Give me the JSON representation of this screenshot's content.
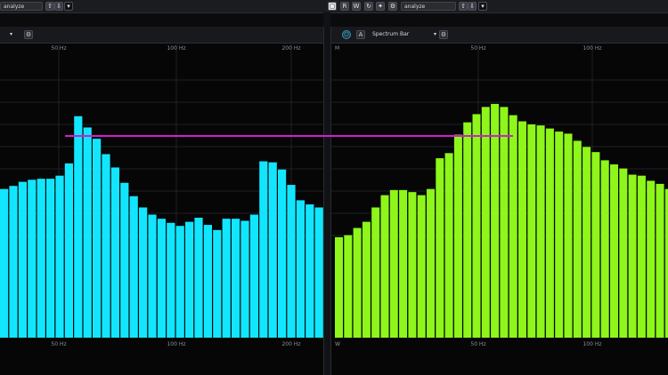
{
  "top_toolbar": {
    "left_dropdown": {
      "value": "analyze"
    },
    "right_dropdown": {
      "value": "analyze"
    },
    "buttons": [
      "R",
      "W",
      "↻",
      "✦",
      "⚙"
    ],
    "arrows": [
      "⇧",
      "⇩"
    ],
    "expand": "▾"
  },
  "panels": {
    "left": {
      "header": {
        "dropdown_chev": "▾",
        "settings": "⚙"
      },
      "tick_labels_top": [
        "50 Hz",
        "100 Hz",
        "200 Hz"
      ],
      "tick_labels_bottom": [
        "50 Hz",
        "100 Hz",
        "200 Hz"
      ]
    },
    "right": {
      "header": {
        "power_icon": "⏻",
        "a_button": "A",
        "mode_label": "Spectrum Bar",
        "dropdown_chev": "▾",
        "settings": "⚙"
      },
      "corner_top": "M",
      "corner_bottom": "W",
      "tick_labels_top": [
        "50 Hz",
        "100 Hz"
      ],
      "tick_labels_bottom": [
        "50 Hz",
        "100 Hz"
      ]
    }
  },
  "chart_data": [
    {
      "type": "bar",
      "series": [
        {
          "values": [
            145,
            148,
            152,
            154,
            155,
            155,
            158,
            170,
            216,
            205,
            194,
            179,
            166,
            151,
            138,
            127,
            120,
            116,
            112,
            109,
            113,
            117,
            110,
            105,
            116,
            116,
            114,
            120,
            172,
            171,
            164,
            149,
            134,
            130,
            127
          ]
        }
      ],
      "ylim": [
        0,
        260
      ],
      "color": "#12e6ff"
    },
    {
      "type": "bar",
      "series": [
        {
          "values": [
            98,
            100,
            107,
            113,
            127,
            139,
            144,
            144,
            142,
            139,
            145,
            175,
            180,
            198,
            210,
            218,
            225,
            228,
            225,
            217,
            211,
            208,
            207,
            204,
            201,
            199,
            192,
            186,
            181,
            173,
            169,
            165,
            159,
            158,
            153,
            150,
            145,
            144,
            150
          ]
        }
      ],
      "ylim": [
        0,
        260
      ],
      "color": "#8ef61a"
    }
  ]
}
